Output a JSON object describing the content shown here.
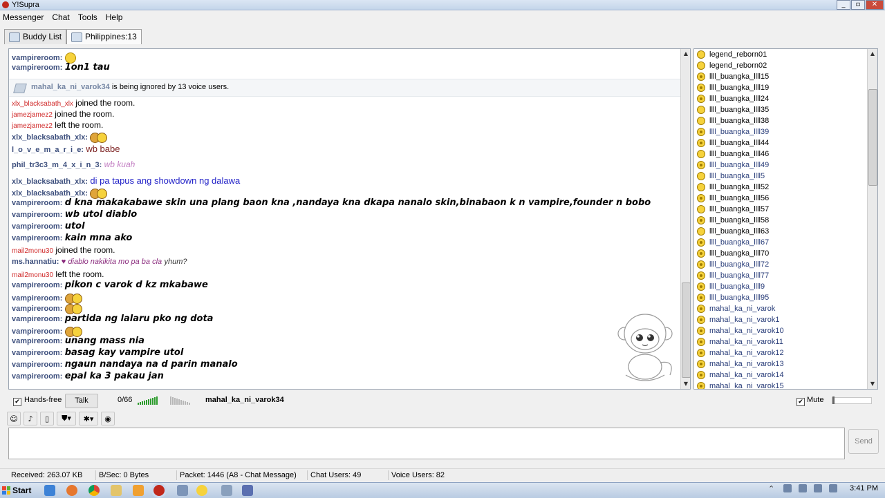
{
  "window": {
    "title": "Y!Supra",
    "controls": [
      "_",
      "▫",
      "✕"
    ]
  },
  "menu": [
    "Messenger",
    "Chat",
    "Tools",
    "Help"
  ],
  "tabs": [
    {
      "label": "Buddy List"
    },
    {
      "label": "Philippines:13"
    }
  ],
  "ignore_notice": {
    "user": "mahal_ka_ni_varok34",
    "text": "is being ignored by 13 voice users."
  },
  "messages": [
    {
      "type": "msg",
      "name": "vampireroom:",
      "emoji": "smile"
    },
    {
      "type": "msg",
      "name": "vampireroom:",
      "text": "1on1 tau",
      "style": "bi"
    },
    {
      "type": "gap"
    },
    {
      "type": "sys",
      "name": "xlx_blacksabath_xlx",
      "text": "joined the room."
    },
    {
      "type": "sys",
      "name": "jamezjamez2",
      "text": "joined the room."
    },
    {
      "type": "sys",
      "name": "jamezjamez2",
      "text": "left the room."
    },
    {
      "type": "msg",
      "name": "xlx_blacksabath_xlx:",
      "emoji": "pair"
    },
    {
      "type": "msg",
      "name": "l_o_v_e_m_a_r_i_e:",
      "text": "wb babe",
      "color": "#7a1e1e",
      "size": 13
    },
    {
      "type": "msg",
      "name": "phil_tr3c3_m_4_x_i_n_3:",
      "text": "wb kuah",
      "color": "#c37fc3",
      "italic": true,
      "size": 12
    },
    {
      "type": "msg",
      "name": "xlx_blacksabath_xlx:",
      "text": "di pa tapus ang showdown ng dalawa",
      "color": "#2424c8",
      "size": 13
    },
    {
      "type": "msg",
      "name": "xlx_blacksabath_xlx:",
      "emoji": "pair"
    },
    {
      "type": "msg",
      "name": "vampireroom:",
      "text": "d kna makakabawe skin una plang baon kna ,nandaya kna dkapa nanalo skin,binabaon k n vampire,founder n bobo",
      "style": "bi"
    },
    {
      "type": "msg",
      "name": "vampireroom:",
      "text": "wb utol diablo",
      "style": "bi"
    },
    {
      "type": "msg",
      "name": "vampireroom:",
      "text": "utol",
      "style": "bi"
    },
    {
      "type": "msg",
      "name": "vampireroom:",
      "text": "kain mna ako",
      "style": "bi"
    },
    {
      "type": "sys",
      "name": "mail2monu30",
      "text": "joined the room."
    },
    {
      "type": "msg",
      "name": "ms.hannatiu:",
      "text": "♥ diablo nakikita mo pa ba cla",
      "tail": "yhum?",
      "color": "#8a2b7d",
      "italic": true,
      "size": 11
    },
    {
      "type": "sys",
      "name": "mail2monu30",
      "text": "left the room."
    },
    {
      "type": "msg",
      "name": "vampireroom:",
      "text": "pikon c varok d kz mkabawe",
      "style": "bi"
    },
    {
      "type": "msg",
      "name": "vampireroom:",
      "emoji": "pair"
    },
    {
      "type": "msg",
      "name": "vampireroom:",
      "emoji": "pair"
    },
    {
      "type": "msg",
      "name": "vampireroom:",
      "text": "partida ng lalaru pko ng dota",
      "style": "bi"
    },
    {
      "type": "msg",
      "name": "vampireroom:",
      "emoji": "pair"
    },
    {
      "type": "msg",
      "name": "vampireroom:",
      "text": "unang mass nia",
      "style": "bi"
    },
    {
      "type": "msg",
      "name": "vampireroom:",
      "text": "basag kay vampire utol",
      "style": "bi"
    },
    {
      "type": "msg",
      "name": "vampireroom:",
      "text": "ngaun nandaya na d parin manalo",
      "style": "bi"
    },
    {
      "type": "msg",
      "name": "vampireroom:",
      "text": "epal ka 3 pakau jan",
      "style": "bi"
    }
  ],
  "users": [
    {
      "name": "legend_reborn01",
      "voice": false,
      "blue": false
    },
    {
      "name": "legend_reborn02",
      "voice": false,
      "blue": false
    },
    {
      "name": "llll_buangka_llll15",
      "voice": true,
      "blue": false
    },
    {
      "name": "llll_buangka_llll19",
      "voice": true,
      "blue": false
    },
    {
      "name": "llll_buangka_llll24",
      "voice": true,
      "blue": false
    },
    {
      "name": "llll_buangka_llll35",
      "voice": false,
      "blue": false
    },
    {
      "name": "llll_buangka_llll38",
      "voice": false,
      "blue": false
    },
    {
      "name": "llll_buangka_llll39",
      "voice": true,
      "blue": true
    },
    {
      "name": "llll_buangka_llll44",
      "voice": true,
      "blue": false
    },
    {
      "name": "llll_buangka_llll46",
      "voice": false,
      "blue": false
    },
    {
      "name": "llll_buangka_llll49",
      "voice": true,
      "blue": true
    },
    {
      "name": "llll_buangka_llll5",
      "voice": false,
      "blue": true
    },
    {
      "name": "llll_buangka_llll52",
      "voice": false,
      "blue": false
    },
    {
      "name": "llll_buangka_llll56",
      "voice": true,
      "blue": false
    },
    {
      "name": "llll_buangka_llll57",
      "voice": false,
      "blue": false
    },
    {
      "name": "llll_buangka_llll58",
      "voice": true,
      "blue": false
    },
    {
      "name": "llll_buangka_llll63",
      "voice": false,
      "blue": false
    },
    {
      "name": "llll_buangka_llll67",
      "voice": true,
      "blue": true
    },
    {
      "name": "llll_buangka_llll70",
      "voice": true,
      "blue": false
    },
    {
      "name": "llll_buangka_llll72",
      "voice": true,
      "blue": true
    },
    {
      "name": "llll_buangka_llll77",
      "voice": true,
      "blue": true
    },
    {
      "name": "llll_buangka_llll9",
      "voice": true,
      "blue": true
    },
    {
      "name": "llll_buangka_llll95",
      "voice": true,
      "blue": true
    },
    {
      "name": "mahal_ka_ni_varok",
      "voice": true,
      "blue": true
    },
    {
      "name": "mahal_ka_ni_varok1",
      "voice": true,
      "blue": true
    },
    {
      "name": "mahal_ka_ni_varok10",
      "voice": true,
      "blue": true
    },
    {
      "name": "mahal_ka_ni_varok11",
      "voice": true,
      "blue": true
    },
    {
      "name": "mahal_ka_ni_varok12",
      "voice": true,
      "blue": true
    },
    {
      "name": "mahal_ka_ni_varok13",
      "voice": true,
      "blue": true
    },
    {
      "name": "mahal_ka_ni_varok14",
      "voice": true,
      "blue": true
    },
    {
      "name": "mahal_ka_ni_varok15",
      "voice": true,
      "blue": true
    }
  ],
  "voice": {
    "handsfree_label": "Hands-free",
    "handsfree_checked": true,
    "talk_label": "Talk",
    "count": "0/66",
    "speaker": "mahal_ka_ni_varok34",
    "mute_label": "Mute",
    "mute_checked": true
  },
  "send_label": "Send",
  "status": {
    "received": "Received: 263.07 KB",
    "bps": "B/Sec: 0 Bytes",
    "packet": "Packet: 1446 (A8 - Chat Message)",
    "chat_users": "Chat Users: 49",
    "voice_users": "Voice Users: 82"
  },
  "taskbar": {
    "start_label": "Start",
    "clock": "3:41 PM"
  },
  "colors": {
    "name": "#3d4f7d",
    "join_name": "#d02a2a",
    "accent": "#4a6fa5"
  }
}
